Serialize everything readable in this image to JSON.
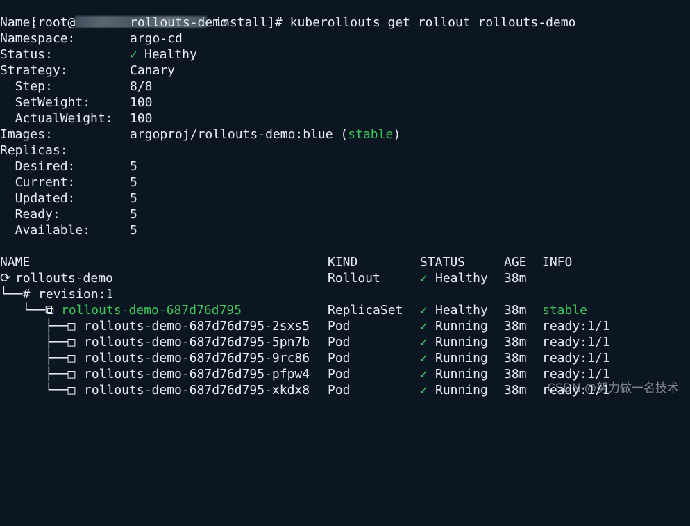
{
  "prompt": {
    "prefix": "[root@",
    "suffix": " install]# ",
    "command": "kuberollouts get rollout rollouts-demo"
  },
  "info": {
    "name_label": "Name:",
    "name_value": "rollouts-demo",
    "namespace_label": "Namespace:",
    "namespace_value": "argo-cd",
    "status_label": "Status:",
    "status_icon": "✓",
    "status_value": "Healthy",
    "strategy_label": "Strategy:",
    "strategy_value": "Canary",
    "step_label": "  Step:",
    "step_value": "8/8",
    "setweight_label": "  SetWeight:",
    "setweight_value": "100",
    "actualweight_label": "  ActualWeight:",
    "actualweight_value": "100",
    "images_label": "Images:",
    "images_value": "argoproj/rollouts-demo:blue (",
    "images_tag": "stable",
    "images_close": ")",
    "replicas_label": "Replicas:",
    "desired_label": "  Desired:",
    "desired_value": "5",
    "current_label": "  Current:",
    "current_value": "5",
    "updated_label": "  Updated:",
    "updated_value": "5",
    "ready_label": "  Ready:",
    "ready_value": "5",
    "available_label": "  Available:",
    "available_value": "5"
  },
  "table": {
    "headers": {
      "name": "NAME",
      "kind": "KIND",
      "status": "STATUS",
      "age": "AGE",
      "info": "INFO"
    },
    "rows": [
      {
        "prefix": "⟳ ",
        "name": "rollouts-demo",
        "kind": "Rollout",
        "icon": "✓",
        "status": "Healthy",
        "age": "38m",
        "info": ""
      },
      {
        "prefix": "└──# ",
        "name": "revision:1",
        "kind": "",
        "icon": "",
        "status": "",
        "age": "",
        "info": ""
      },
      {
        "prefix": "   └──⧉ ",
        "name": "rollouts-demo-687d76d795",
        "kind": "ReplicaSet",
        "icon": "✓",
        "status": "Healthy",
        "age": "38m",
        "info": "stable"
      },
      {
        "prefix": "      ├──□ ",
        "name": "rollouts-demo-687d76d795-2sxs5",
        "kind": "Pod",
        "icon": "✓",
        "status": "Running",
        "age": "38m",
        "info": "ready:1/1"
      },
      {
        "prefix": "      ├──□ ",
        "name": "rollouts-demo-687d76d795-5pn7b",
        "kind": "Pod",
        "icon": "✓",
        "status": "Running",
        "age": "38m",
        "info": "ready:1/1"
      },
      {
        "prefix": "      ├──□ ",
        "name": "rollouts-demo-687d76d795-9rc86",
        "kind": "Pod",
        "icon": "✓",
        "status": "Running",
        "age": "38m",
        "info": "ready:1/1"
      },
      {
        "prefix": "      ├──□ ",
        "name": "rollouts-demo-687d76d795-pfpw4",
        "kind": "Pod",
        "icon": "✓",
        "status": "Running",
        "age": "38m",
        "info": "ready:1/1"
      },
      {
        "prefix": "      └──□ ",
        "name": "rollouts-demo-687d76d795-xkdx8",
        "kind": "Pod",
        "icon": "✓",
        "status": "Running",
        "age": "38m",
        "info": "ready:1/1"
      }
    ]
  },
  "watermark": "CSDN @努力做一名技术",
  "colors": {
    "background": "#0c1622",
    "text": "#e6eef5",
    "healthy": "#3ec45a"
  }
}
